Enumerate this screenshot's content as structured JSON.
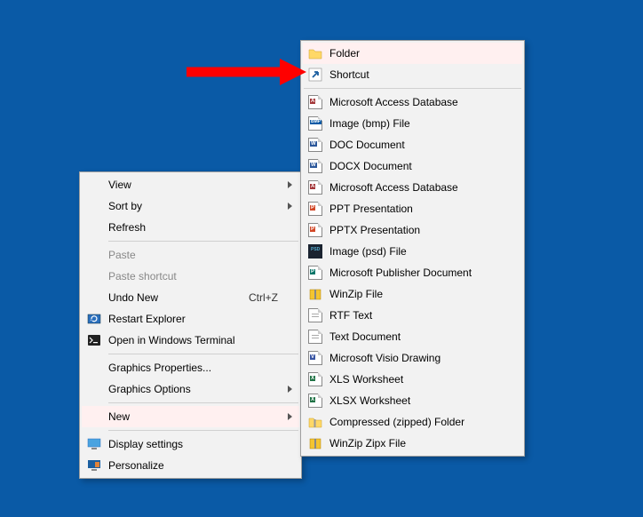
{
  "context_menu": {
    "items": [
      {
        "label": "View",
        "submenu": true
      },
      {
        "label": "Sort by",
        "submenu": true
      },
      {
        "label": "Refresh"
      }
    ],
    "items2": [
      {
        "label": "Paste",
        "disabled": true
      },
      {
        "label": "Paste shortcut",
        "disabled": true
      },
      {
        "label": "Undo New",
        "shortcut": "Ctrl+Z"
      },
      {
        "label": "Restart Explorer",
        "icon": "restart-explorer-icon"
      },
      {
        "label": "Open in Windows Terminal",
        "icon": "terminal-icon"
      }
    ],
    "items3": [
      {
        "label": "Graphics Properties..."
      },
      {
        "label": "Graphics Options",
        "submenu": true
      }
    ],
    "items4": [
      {
        "label": "New",
        "submenu": true,
        "highlighted": true
      }
    ],
    "items5": [
      {
        "label": "Display settings",
        "icon": "display-settings-icon"
      },
      {
        "label": "Personalize",
        "icon": "personalize-icon"
      }
    ]
  },
  "new_submenu": {
    "groups": [
      [
        {
          "label": "Folder",
          "icon": "folder-icon",
          "highlighted": true
        },
        {
          "label": "Shortcut",
          "icon": "shortcut-icon"
        }
      ],
      [
        {
          "label": "Microsoft Access Database",
          "icon": "access-icon"
        },
        {
          "label": "Image (bmp) File",
          "icon": "bmp-icon"
        },
        {
          "label": "DOC Document",
          "icon": "doc-icon"
        },
        {
          "label": "DOCX Document",
          "icon": "docx-icon"
        },
        {
          "label": "Microsoft Access Database",
          "icon": "access-icon"
        },
        {
          "label": "PPT Presentation",
          "icon": "ppt-icon"
        },
        {
          "label": "PPTX Presentation",
          "icon": "pptx-icon"
        },
        {
          "label": "Image (psd) File",
          "icon": "psd-icon"
        },
        {
          "label": "Microsoft Publisher Document",
          "icon": "publisher-icon"
        },
        {
          "label": "WinZip File",
          "icon": "winzip-icon"
        },
        {
          "label": "RTF Text",
          "icon": "rtf-icon"
        },
        {
          "label": "Text Document",
          "icon": "text-icon"
        },
        {
          "label": "Microsoft Visio Drawing",
          "icon": "visio-icon"
        },
        {
          "label": "XLS Worksheet",
          "icon": "xls-icon"
        },
        {
          "label": "XLSX Worksheet",
          "icon": "xlsx-icon"
        },
        {
          "label": "Compressed (zipped) Folder",
          "icon": "zipped-folder-icon"
        },
        {
          "label": "WinZip Zipx File",
          "icon": "winzip-zipx-icon"
        }
      ]
    ]
  }
}
